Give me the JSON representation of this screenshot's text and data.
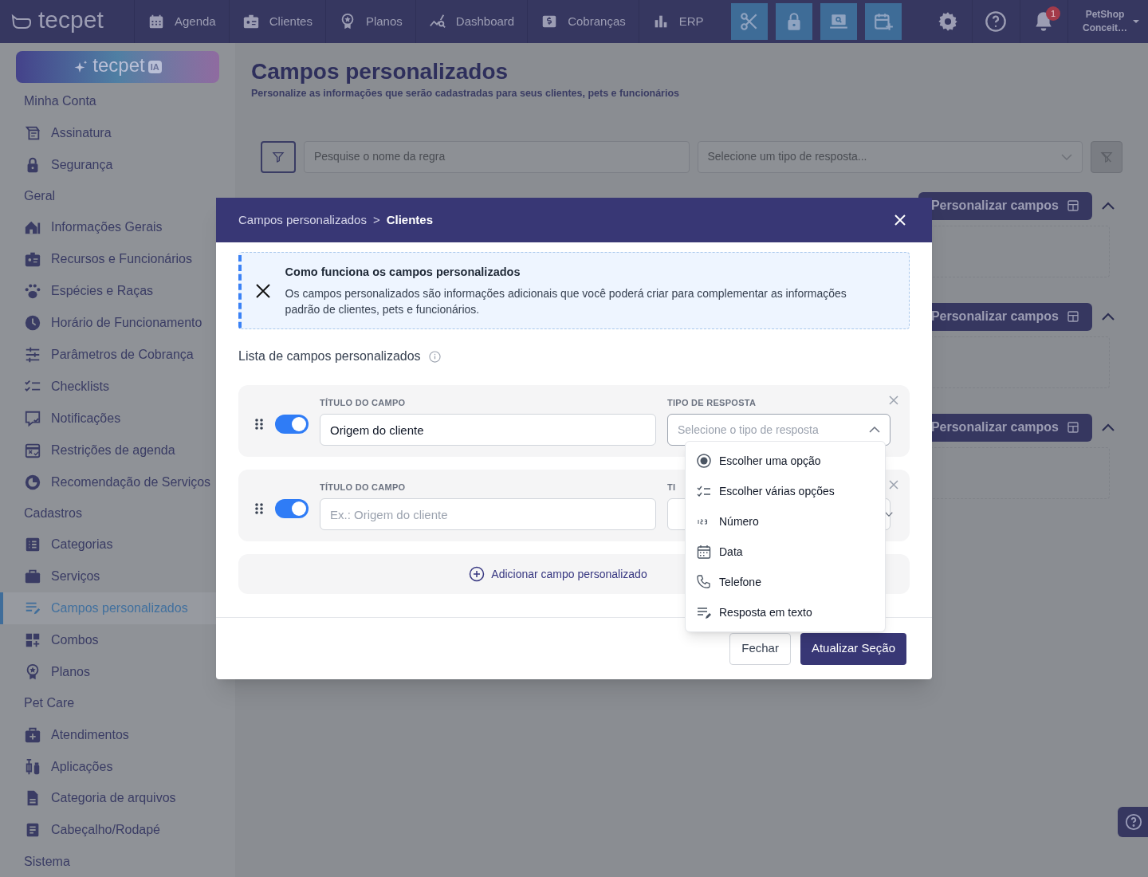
{
  "navbar": {
    "logo": "tecpet",
    "items": [
      {
        "label": "Agenda"
      },
      {
        "label": "Clientes"
      },
      {
        "label": "Planos"
      },
      {
        "label": "Dashboard"
      },
      {
        "label": "Cobranças"
      },
      {
        "label": "ERP"
      }
    ],
    "notification_count": "1",
    "account": {
      "name": "PetShop",
      "unit": "Conceit…"
    }
  },
  "sidebar": {
    "ai_banner": {
      "text": "tecpet",
      "badge": "IA"
    },
    "sections": [
      {
        "title": "Minha Conta",
        "items": [
          {
            "label": "Assinatura",
            "selected": false
          },
          {
            "label": "Segurança",
            "selected": false
          }
        ]
      },
      {
        "title": "Geral",
        "items": [
          {
            "label": "Informações Gerais",
            "selected": false
          },
          {
            "label": "Recursos e Funcionários",
            "selected": false
          },
          {
            "label": "Espécies e Raças",
            "selected": false
          },
          {
            "label": "Horário de Funcionamento",
            "selected": false
          },
          {
            "label": "Parâmetros de Cobrança",
            "selected": false
          },
          {
            "label": "Checklists",
            "selected": false
          },
          {
            "label": "Notificações",
            "selected": false
          },
          {
            "label": "Restrições de agenda",
            "selected": false
          },
          {
            "label": "Recomendação de Serviços",
            "selected": false
          }
        ]
      },
      {
        "title": "Cadastros",
        "items": [
          {
            "label": "Categorias",
            "selected": false
          },
          {
            "label": "Serviços",
            "selected": false
          },
          {
            "label": "Campos personalizados",
            "selected": true
          },
          {
            "label": "Combos",
            "selected": false
          },
          {
            "label": "Planos",
            "selected": false
          }
        ]
      },
      {
        "title": "Pet Care",
        "items": [
          {
            "label": "Atendimentos",
            "selected": false
          },
          {
            "label": "Aplicações",
            "selected": false
          },
          {
            "label": "Categoria de arquivos",
            "selected": false
          },
          {
            "label": "Cabeçalho/Rodapé",
            "selected": false
          }
        ]
      },
      {
        "title": "Sistema"
      }
    ]
  },
  "page": {
    "title": "Campos personalizados",
    "subtitle": "Personalize as informações que serão cadastradas para seus clientes, pets e funcionários",
    "filters": {
      "search_placeholder": "Pesquise o nome da regra",
      "type_placeholder": "Selecione um tipo de resposta..."
    },
    "sections": [
      {
        "button": "Personalizar campos",
        "expanded": true
      },
      {
        "button": "Personalizar campos",
        "expanded": true
      },
      {
        "button": "Personalizar campos",
        "expanded": true
      }
    ]
  },
  "modal": {
    "breadcrumb": [
      "Campos personalizados",
      "Clientes"
    ],
    "breadcrumb_separator": ">",
    "info": {
      "title": "Como funciona os campos personalizados",
      "text": "Os campos personalizados são informações adicionais que você poderá criar para complementar as informações padrão de clientes, pets e funcionários."
    },
    "list_title": "Lista de campos personalizados",
    "fields": [
      {
        "title_label": "TÍTULO DO CAMPO",
        "title_value": "Origem do cliente",
        "type_label": "TIPO DE RESPOSTA",
        "type_placeholder": "Selecione o tipo de resposta",
        "enabled": true,
        "open": true
      },
      {
        "title_label": "TÍTULO DO CAMPO",
        "title_placeholder": "Ex.: Origem do cliente",
        "type_label": "TI",
        "enabled": true,
        "open": false
      }
    ],
    "add_button": "Adicionar campo personalizado",
    "dropdown_options": [
      {
        "label": "Escolher uma opção"
      },
      {
        "label": "Escolher várias opções"
      },
      {
        "label": "Número"
      },
      {
        "label": "Data"
      },
      {
        "label": "Telefone"
      },
      {
        "label": "Resposta em texto"
      }
    ],
    "buttons": {
      "close": "Fechar",
      "submit": "Atualizar Seção"
    }
  }
}
